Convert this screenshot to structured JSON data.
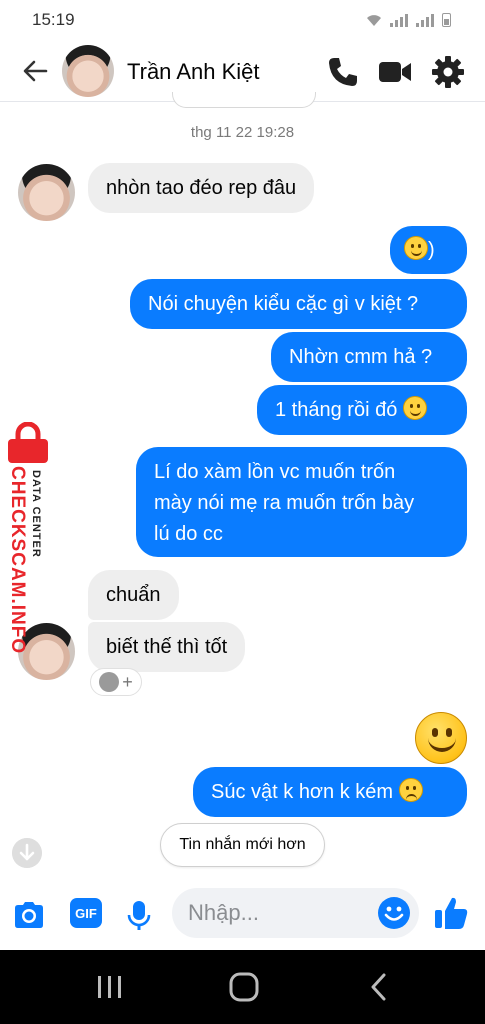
{
  "status_bar": {
    "time": "15:19"
  },
  "header": {
    "contact_name": "Trần Anh Kiệt",
    "icons": [
      "back-arrow-icon",
      "phone-icon",
      "video-camera-icon",
      "gear-icon"
    ]
  },
  "chat": {
    "timestamp": "thg 11 22 19:28",
    "messages": [
      {
        "from": "contact",
        "text": "nhòn tao đéo rep đâu"
      },
      {
        "from": "me",
        "text": ")",
        "emoji": "smile"
      },
      {
        "from": "me",
        "text": "Nói chuyện kiểu cặc gì v kiệt ?"
      },
      {
        "from": "me",
        "text": "Nhờn cmm hả ?"
      },
      {
        "from": "me",
        "text": "1 tháng rồi đó",
        "emoji": "smile"
      },
      {
        "from": "me",
        "lines": [
          "Lí do xàm lồn vc muốn trốn",
          "mày nói mẹ ra muốn trốn bày",
          "lú do cc"
        ]
      },
      {
        "from": "contact",
        "text": "chuẩn"
      },
      {
        "from": "contact",
        "text": "biết thế thì tốt",
        "reaction": "+"
      },
      {
        "from": "me",
        "emoji": "big-smile"
      },
      {
        "from": "me",
        "text": "Súc vật k hơn k kém",
        "emoji": "disappointed"
      }
    ],
    "new_messages_button": "Tin nhắn mới hơn"
  },
  "watermark": {
    "brand": "CHECKSCAM.INFO",
    "sub": "DATA CENTER"
  },
  "composer": {
    "placeholder": "Nhập...",
    "gif_label": "GIF"
  },
  "colors": {
    "sent_bubble": "#0a7cff",
    "received_bubble": "#eeeeee",
    "watermark_red": "#e8262b"
  }
}
